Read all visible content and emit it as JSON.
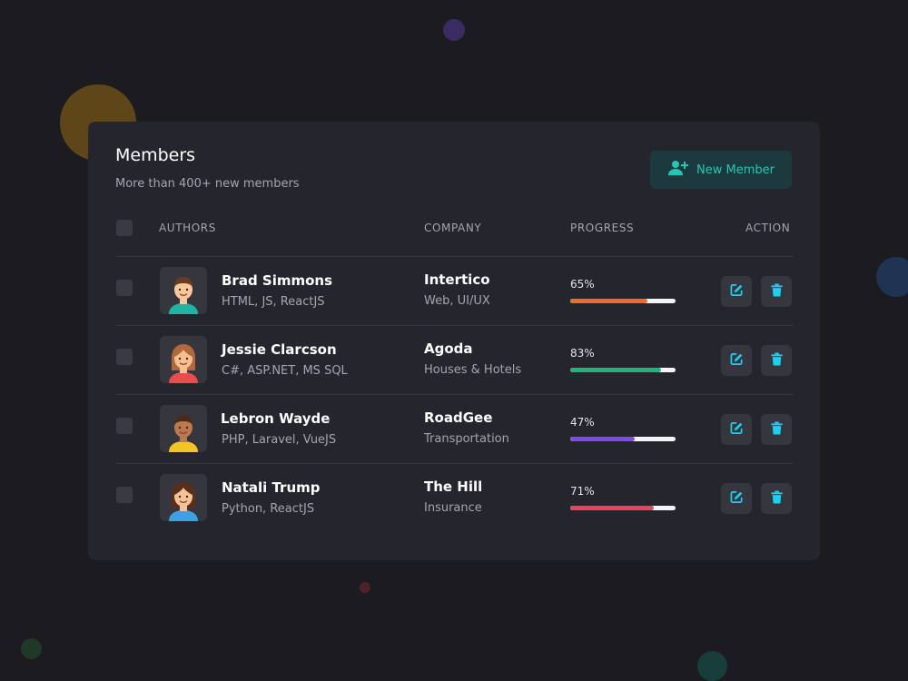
{
  "header": {
    "title": "Members",
    "subtitle": "More than 400+ new members",
    "new_member_label": "New Member",
    "new_member_icon": "user-plus-icon"
  },
  "columns": {
    "authors": "AUTHORS",
    "company": "COMPANY",
    "progress": "PROGRESS",
    "action": "ACTION"
  },
  "members": [
    {
      "name": "Brad Simmons",
      "skills": "HTML, JS, ReactJS",
      "company": "Intertico",
      "sector": "Web, UI/UX",
      "progress_label": "65%",
      "progress": 0.73,
      "color": "#f06b2b",
      "avatar": "avatar-boy"
    },
    {
      "name": "Jessie Clarcson",
      "skills": "C#, ASP.NET, MS SQL",
      "company": "Agoda",
      "sector": "Houses & Hotels",
      "progress_label": "83%",
      "progress": 0.86,
      "color": "#1fb57a",
      "avatar": "avatar-girl-red"
    },
    {
      "name": "Lebron Wayde",
      "skills": "PHP, Laravel, VueJS",
      "company": "RoadGee",
      "sector": "Transportation",
      "progress_label": "47%",
      "progress": 0.61,
      "color": "#7d4cf0",
      "avatar": "avatar-boy-yellow"
    },
    {
      "name": "Natali Trump",
      "skills": "Python, ReactJS",
      "company": "The Hill",
      "sector": "Insurance",
      "progress_label": "71%",
      "progress": 0.79,
      "color": "#ef3f5f",
      "avatar": "avatar-girl-blue"
    }
  ],
  "colors": {
    "accent": "#22c7b5",
    "card": "#25252d",
    "background": "#1b1b20",
    "action_icon": "#1ad2f0"
  }
}
